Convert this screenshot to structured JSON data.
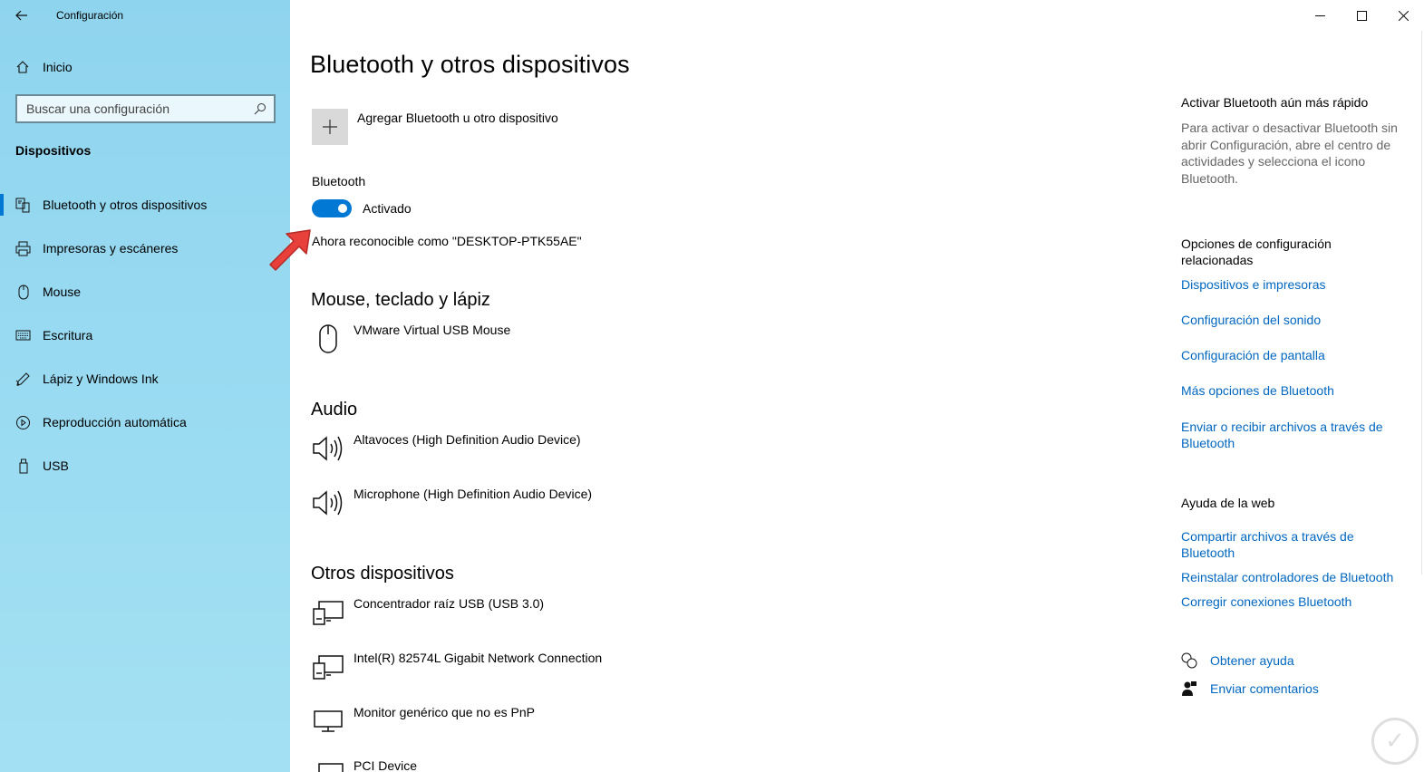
{
  "window": {
    "title": "Configuración",
    "back_icon": "arrow-left-icon",
    "controls": [
      "minimize",
      "maximize",
      "close"
    ]
  },
  "sidebar": {
    "home_label": "Inicio",
    "search_placeholder": "Buscar una configuración",
    "section_title": "Dispositivos",
    "items": [
      {
        "label": "Bluetooth y otros dispositivos",
        "icon": "bluetooth-devices-icon",
        "active": true
      },
      {
        "label": "Impresoras y escáneres",
        "icon": "printer-icon",
        "active": false
      },
      {
        "label": "Mouse",
        "icon": "mouse-icon",
        "active": false
      },
      {
        "label": "Escritura",
        "icon": "keyboard-icon",
        "active": false
      },
      {
        "label": "Lápiz y Windows Ink",
        "icon": "pen-icon",
        "active": false
      },
      {
        "label": "Reproducción automática",
        "icon": "autoplay-icon",
        "active": false
      },
      {
        "label": "USB",
        "icon": "usb-icon",
        "active": false
      }
    ]
  },
  "main": {
    "title": "Bluetooth y otros dispositivos",
    "add_device_label": "Agregar Bluetooth u otro dispositivo",
    "bluetooth_label": "Bluetooth",
    "bluetooth_state": "Activado",
    "bluetooth_on": true,
    "discoverable_text": "Ahora reconocible como \"DESKTOP-PTK55AE\"",
    "groups": {
      "input": {
        "title": "Mouse, teclado y lápiz",
        "devices": [
          "VMware Virtual USB Mouse"
        ]
      },
      "audio": {
        "title": "Audio",
        "devices": [
          "Altavoces (High Definition Audio Device)",
          "Microphone (High Definition Audio Device)"
        ]
      },
      "other": {
        "title": "Otros dispositivos",
        "devices": [
          "Concentrador raíz USB (USB 3.0)",
          "Intel(R) 82574L Gigabit Network Connection",
          "Monitor genérico que no es PnP",
          "PCI Device"
        ]
      }
    }
  },
  "right": {
    "tip_title": "Activar Bluetooth aún más rápido",
    "tip_text": "Para activar o desactivar Bluetooth sin abrir Configuración, abre el centro de actividades y selecciona el icono Bluetooth.",
    "related_title": "Opciones de configuración relacionadas",
    "related_links": [
      "Dispositivos e impresoras",
      "Configuración del sonido",
      "Configuración de pantalla",
      "Más opciones de Bluetooth",
      "Enviar o recibir archivos a través de Bluetooth"
    ],
    "web_help_title": "Ayuda de la web",
    "web_links": [
      "Compartir archivos a través de Bluetooth",
      "Reinstalar controladores de Bluetooth",
      "Corregir conexiones Bluetooth"
    ],
    "get_help": "Obtener ayuda",
    "send_feedback": "Enviar comentarios"
  },
  "colors": {
    "accent": "#0078d4",
    "link": "#0067c0",
    "sidebar_bg": "#9bdcf2",
    "annotation_arrow": "#e8413c"
  }
}
